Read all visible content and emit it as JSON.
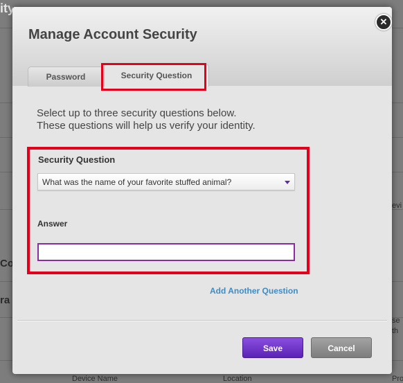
{
  "background_fragments": {
    "top_left": "ity",
    "left_mid": "Co",
    "left_lower": "ra",
    "right_1": "evi",
    "right_2": "se",
    "right_3": "th",
    "bottom_left": "Device Name",
    "bottom_mid": "Location",
    "bottom_right": "Protected"
  },
  "modal": {
    "title": "Manage Account Security",
    "close_glyph": "✕",
    "tabs": [
      {
        "label": "Password",
        "active": false
      },
      {
        "label": "Security Question",
        "active": true
      }
    ],
    "intro_line1": "Select up to three security questions below.",
    "intro_line2": "These questions will help us verify your identity.",
    "question_label": "Security Question",
    "question_selected": "What was the name of your favorite stuffed animal?",
    "answer_label": "Answer",
    "answer_value": "",
    "add_link": "Add Another Question",
    "save_label": "Save",
    "cancel_label": "Cancel"
  },
  "colors": {
    "highlight": "#e4001b",
    "primary_button": "#6a32c8",
    "link": "#3f8bc4",
    "input_border": "#8a2ca0"
  }
}
